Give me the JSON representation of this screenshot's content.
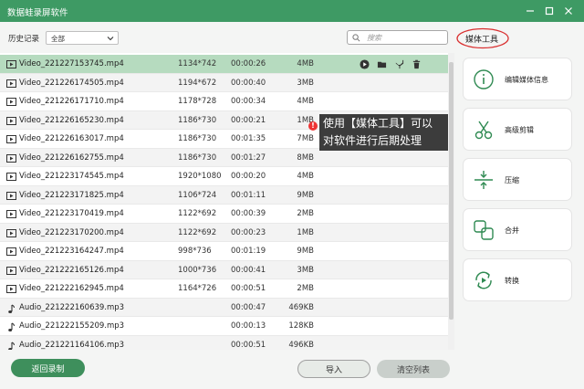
{
  "window": {
    "title": "数据蛙录屏软件"
  },
  "filter": {
    "label": "历史记录",
    "selected": "全部",
    "search_placeholder": "搜索"
  },
  "rows": [
    {
      "type": "video",
      "name": "Video_221227153745.mp4",
      "resolution": "1134*742",
      "duration": "00:00:26",
      "size": "4MB",
      "selected": true
    },
    {
      "type": "video",
      "name": "Video_221226174505.mp4",
      "resolution": "1194*672",
      "duration": "00:00:40",
      "size": "3MB"
    },
    {
      "type": "video",
      "name": "Video_221226171710.mp4",
      "resolution": "1178*728",
      "duration": "00:00:34",
      "size": "4MB"
    },
    {
      "type": "video",
      "name": "Video_221226165230.mp4",
      "resolution": "1186*730",
      "duration": "00:00:21",
      "size": "1MB"
    },
    {
      "type": "video",
      "name": "Video_221226163017.mp4",
      "resolution": "1186*730",
      "duration": "00:01:35",
      "size": "7MB"
    },
    {
      "type": "video",
      "name": "Video_221226162755.mp4",
      "resolution": "1186*730",
      "duration": "00:01:27",
      "size": "8MB"
    },
    {
      "type": "video",
      "name": "Video_221223174545.mp4",
      "resolution": "1920*1080",
      "duration": "00:00:20",
      "size": "4MB"
    },
    {
      "type": "video",
      "name": "Video_221223171825.mp4",
      "resolution": "1106*724",
      "duration": "00:01:11",
      "size": "9MB"
    },
    {
      "type": "video",
      "name": "Video_221223170419.mp4",
      "resolution": "1122*692",
      "duration": "00:00:39",
      "size": "2MB"
    },
    {
      "type": "video",
      "name": "Video_221223170200.mp4",
      "resolution": "1122*692",
      "duration": "00:00:23",
      "size": "1MB"
    },
    {
      "type": "video",
      "name": "Video_221223164247.mp4",
      "resolution": "998*736",
      "duration": "00:01:19",
      "size": "9MB"
    },
    {
      "type": "video",
      "name": "Video_221222165126.mp4",
      "resolution": "1000*736",
      "duration": "00:00:41",
      "size": "3MB"
    },
    {
      "type": "video",
      "name": "Video_221222162945.mp4",
      "resolution": "1164*726",
      "duration": "00:00:51",
      "size": "2MB"
    },
    {
      "type": "audio",
      "name": "Audio_221222160639.mp3",
      "resolution": "",
      "duration": "00:00:47",
      "size": "469KB"
    },
    {
      "type": "audio",
      "name": "Audio_221222155209.mp3",
      "resolution": "",
      "duration": "00:00:13",
      "size": "128KB"
    },
    {
      "type": "audio",
      "name": "Audio_221221164106.mp3",
      "resolution": "",
      "duration": "00:00:51",
      "size": "496KB"
    }
  ],
  "row_actions": [
    "play-icon",
    "folder-icon",
    "edit-tools-icon",
    "delete-icon"
  ],
  "tooltip": {
    "line1": "使用【媒体工具】可以",
    "line2": "对软件进行后期处理",
    "badge": "!"
  },
  "media_tools": {
    "header": "媒体工具",
    "items": [
      {
        "label": "编辑媒体信息",
        "icon": "info-icon"
      },
      {
        "label": "高级剪辑",
        "icon": "scissors-icon"
      },
      {
        "label": "压缩",
        "icon": "compress-icon"
      },
      {
        "label": "合并",
        "icon": "merge-icon"
      },
      {
        "label": "转换",
        "icon": "convert-icon"
      }
    ]
  },
  "buttons": {
    "back": "返回录制",
    "import": "导入",
    "clear": "清空列表"
  },
  "colors": {
    "accent": "#3e9a64",
    "selected_row": "#b6dbbf",
    "highlight_ring": "#d93030"
  }
}
